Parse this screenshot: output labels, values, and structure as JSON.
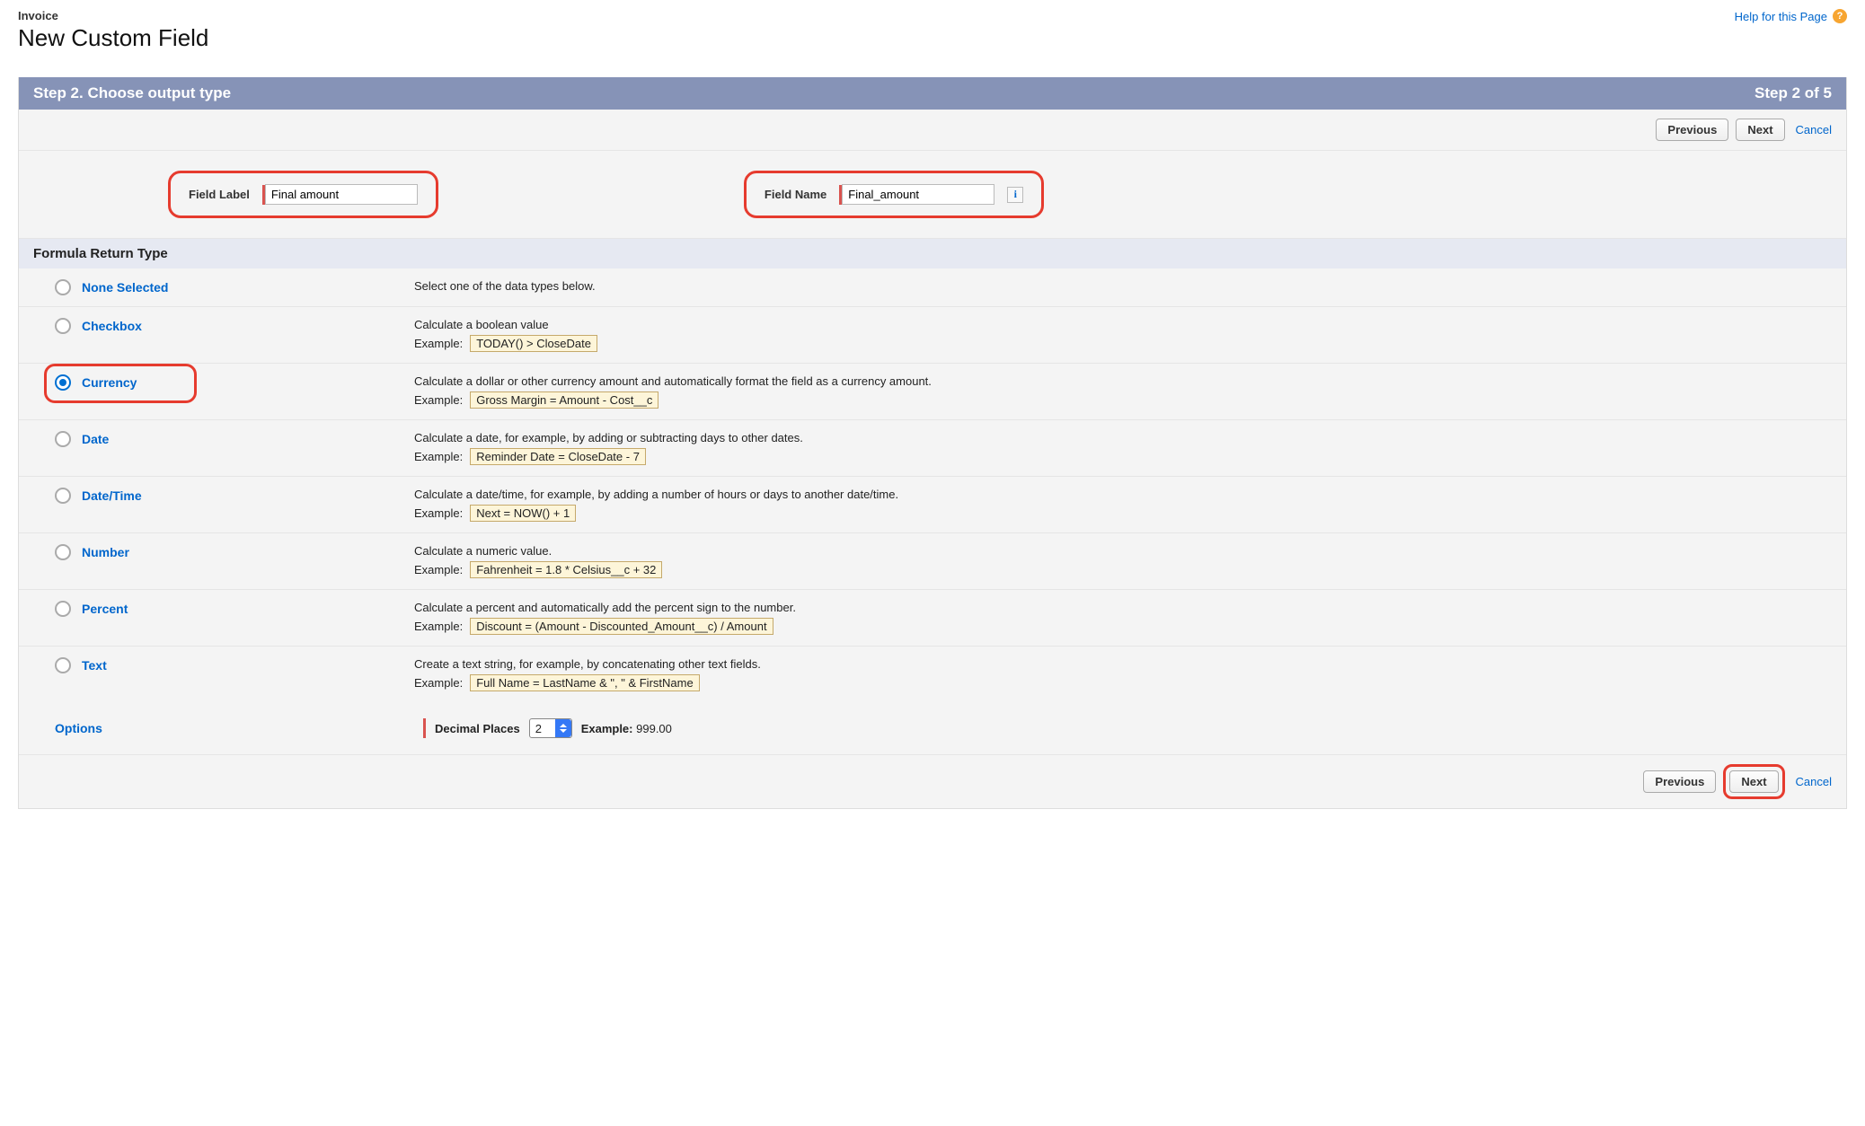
{
  "header": {
    "breadcrumb": "Invoice",
    "title": "New Custom Field",
    "help_link": "Help for this Page",
    "help_icon": "?"
  },
  "step": {
    "title": "Step 2. Choose output type",
    "counter": "Step 2 of 5"
  },
  "buttons": {
    "previous": "Previous",
    "next": "Next",
    "cancel": "Cancel"
  },
  "fields": {
    "label_lbl": "Field Label",
    "label_value": "Final amount",
    "name_lbl": "Field Name",
    "name_value": "Final_amount",
    "info": "i"
  },
  "section": {
    "title": "Formula Return Type"
  },
  "types": {
    "none": {
      "label": "None Selected",
      "desc": "Select one of the data types below."
    },
    "checkbox": {
      "label": "Checkbox",
      "desc": "Calculate a boolean value",
      "example_label": "Example:",
      "example": "TODAY() > CloseDate"
    },
    "currency": {
      "label": "Currency",
      "desc": "Calculate a dollar or other currency amount and automatically format the field as a currency amount.",
      "example_label": "Example:",
      "example": "Gross Margin = Amount - Cost__c"
    },
    "date": {
      "label": "Date",
      "desc": "Calculate a date, for example, by adding or subtracting days to other dates.",
      "example_label": "Example:",
      "example": "Reminder Date = CloseDate - 7"
    },
    "datetime": {
      "label": "Date/Time",
      "desc": "Calculate a date/time, for example, by adding a number of hours or days to another date/time.",
      "example_label": "Example:",
      "example": "Next = NOW() + 1"
    },
    "number": {
      "label": "Number",
      "desc": "Calculate a numeric value.",
      "example_label": "Example:",
      "example": "Fahrenheit = 1.8 * Celsius__c + 32"
    },
    "percent": {
      "label": "Percent",
      "desc": "Calculate a percent and automatically add the percent sign to the number.",
      "example_label": "Example:",
      "example": "Discount = (Amount - Discounted_Amount__c) / Amount"
    },
    "text": {
      "label": "Text",
      "desc": "Create a text string, for example, by concatenating other text fields.",
      "example_label": "Example:",
      "example": "Full Name = LastName & \", \" & FirstName"
    }
  },
  "options": {
    "label": "Options",
    "decimal_label": "Decimal Places",
    "decimal_value": "2",
    "example_prefix": "Example:",
    "example_value": "999.00"
  }
}
